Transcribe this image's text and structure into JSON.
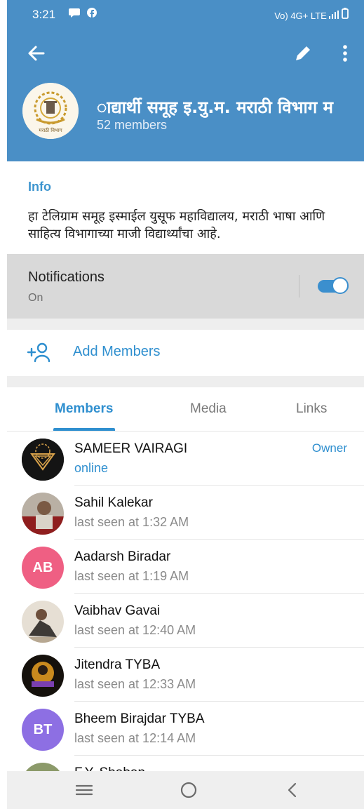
{
  "status_bar": {
    "time": "3:21",
    "network": "Vo) 4G+ LTE"
  },
  "group": {
    "title": "ाद्यार्थी समूह   इ.यु.म. मराठी विभाग म",
    "members_count": "52 members",
    "avatar_text": "मराठी विभाग"
  },
  "info": {
    "label": "Info",
    "description": "हा  टेलिग्राम समूह इस्माईल युसूफ महाविद्यालय, मराठी भाषा आणि साहित्य विभागाच्या माजी विद्यार्थ्यांचा आहे."
  },
  "notifications": {
    "title": "Notifications",
    "status": "On",
    "enabled": true
  },
  "add_members": {
    "label": "Add Members"
  },
  "tabs": [
    {
      "label": "Members",
      "active": true
    },
    {
      "label": "Media",
      "active": false
    },
    {
      "label": "Links",
      "active": false
    }
  ],
  "members": [
    {
      "name": "SAMEER VAIRAGI",
      "status": "online",
      "role": "Owner"
    },
    {
      "name": "Sahil Kalekar",
      "status": "last seen at 1:32 AM",
      "role": ""
    },
    {
      "name": "Aadarsh Biradar",
      "status": "last seen at 1:19 AM",
      "role": "",
      "initials": "AB",
      "avatar_color": "#ef5f83"
    },
    {
      "name": "Vaibhav Gavai",
      "status": "last seen at 12:40 AM",
      "role": ""
    },
    {
      "name": "Jitendra TYBA",
      "status": "last seen at 12:33 AM",
      "role": ""
    },
    {
      "name": "Bheem Birajdar TYBA",
      "status": "last seen at 12:14 AM",
      "role": "",
      "initials": "BT",
      "avatar_color": "#8d6fe3"
    },
    {
      "name": "F.Y. Shaban",
      "status": "",
      "role": ""
    }
  ],
  "colors": {
    "header": "#4a8fc6",
    "accent": "#2f8fcf",
    "notification_bg": "#d9d9d9"
  },
  "icons": {
    "back": "arrow-left-icon",
    "edit": "pencil-icon",
    "more": "more-vertical-icon",
    "add_member": "person-add-icon",
    "nav_menu": "menu-icon",
    "nav_home": "home-icon",
    "nav_back": "chevron-left-icon"
  }
}
